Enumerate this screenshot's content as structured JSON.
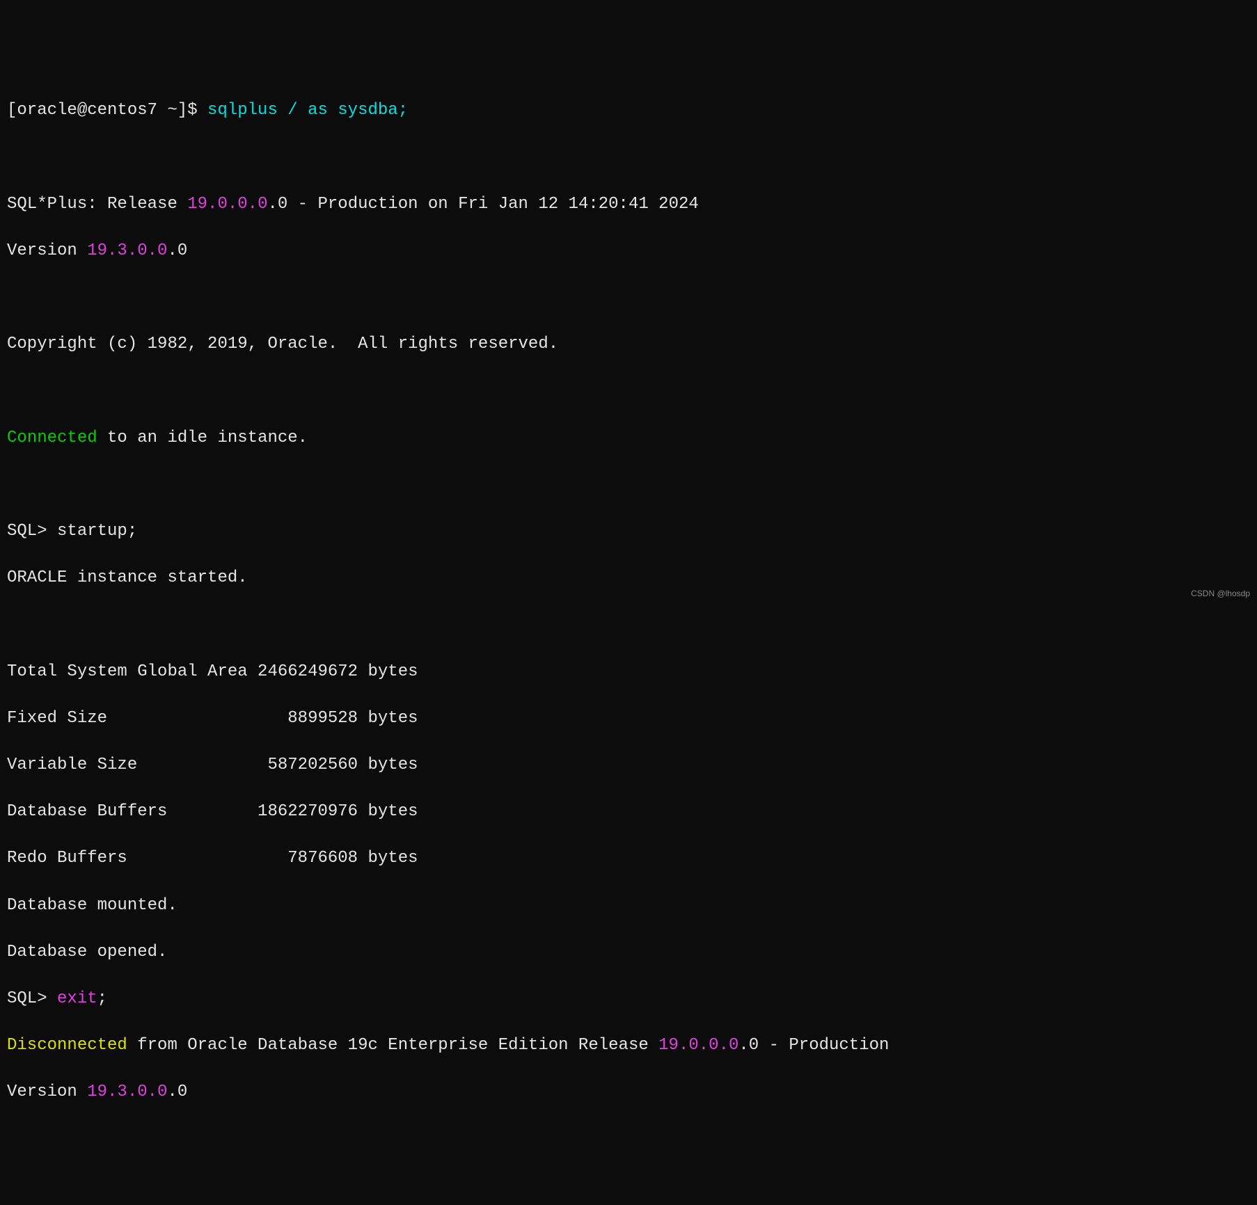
{
  "prompt": {
    "prefix": "[oracle@centos7 ~]$ ",
    "command": "sqlplus / as sysdba;"
  },
  "banner": {
    "line1_a": "SQL*Plus: Release ",
    "line1_b": "19.0.0.0",
    "line1_c": ".0 - Production on Fri Jan 12 14:20:41 2024",
    "version_a": "Version ",
    "version_b": "19.3.0.0",
    "version_c": ".0",
    "copyright": "Copyright (c) 1982, 2019, Oracle.  All rights reserved."
  },
  "connected": {
    "a": "Connected",
    "b": " to an idle instance."
  },
  "sql1": {
    "prompt": "SQL> ",
    "cmd": "startup;"
  },
  "startup": {
    "started": "ORACLE instance started.",
    "sga": "Total System Global Area 2466249672 bytes",
    "fixed": "Fixed Size                  8899528 bytes",
    "var": "Variable Size             587202560 bytes",
    "dbuf": "Database Buffers         1862270976 bytes",
    "redo": "Redo Buffers                7876608 bytes",
    "mounted": "Database mounted.",
    "opened": "Database opened."
  },
  "sql2": {
    "prompt": "SQL> ",
    "cmd_a": "exit",
    "cmd_b": ";"
  },
  "disconnected": {
    "a": "Disconnected",
    "b": " from Oracle Database 19c Enterprise Edition Release ",
    "c": "19.0.0.0",
    "d": ".0 - Production",
    "ver_a": "Version ",
    "ver_b": "19.3.0.0",
    "ver_c": ".0"
  },
  "watermark": "CSDN @lhosdp"
}
